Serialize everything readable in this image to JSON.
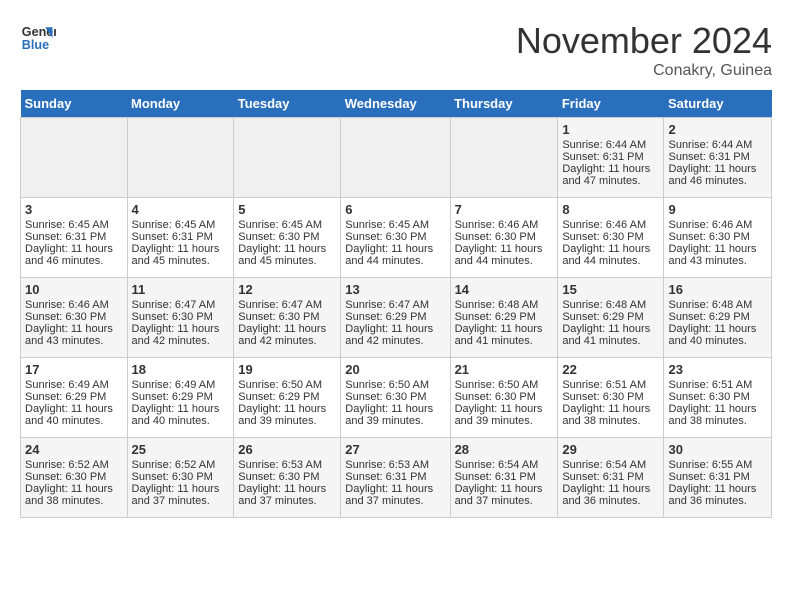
{
  "logo": {
    "line1": "General",
    "line2": "Blue"
  },
  "title": "November 2024",
  "subtitle": "Conakry, Guinea",
  "days_of_week": [
    "Sunday",
    "Monday",
    "Tuesday",
    "Wednesday",
    "Thursday",
    "Friday",
    "Saturday"
  ],
  "weeks": [
    [
      {
        "day": "",
        "content": ""
      },
      {
        "day": "",
        "content": ""
      },
      {
        "day": "",
        "content": ""
      },
      {
        "day": "",
        "content": ""
      },
      {
        "day": "",
        "content": ""
      },
      {
        "day": "1",
        "content": "Sunrise: 6:44 AM\nSunset: 6:31 PM\nDaylight: 11 hours and 47 minutes."
      },
      {
        "day": "2",
        "content": "Sunrise: 6:44 AM\nSunset: 6:31 PM\nDaylight: 11 hours and 46 minutes."
      }
    ],
    [
      {
        "day": "3",
        "content": "Sunrise: 6:45 AM\nSunset: 6:31 PM\nDaylight: 11 hours and 46 minutes."
      },
      {
        "day": "4",
        "content": "Sunrise: 6:45 AM\nSunset: 6:31 PM\nDaylight: 11 hours and 45 minutes."
      },
      {
        "day": "5",
        "content": "Sunrise: 6:45 AM\nSunset: 6:30 PM\nDaylight: 11 hours and 45 minutes."
      },
      {
        "day": "6",
        "content": "Sunrise: 6:45 AM\nSunset: 6:30 PM\nDaylight: 11 hours and 44 minutes."
      },
      {
        "day": "7",
        "content": "Sunrise: 6:46 AM\nSunset: 6:30 PM\nDaylight: 11 hours and 44 minutes."
      },
      {
        "day": "8",
        "content": "Sunrise: 6:46 AM\nSunset: 6:30 PM\nDaylight: 11 hours and 44 minutes."
      },
      {
        "day": "9",
        "content": "Sunrise: 6:46 AM\nSunset: 6:30 PM\nDaylight: 11 hours and 43 minutes."
      }
    ],
    [
      {
        "day": "10",
        "content": "Sunrise: 6:46 AM\nSunset: 6:30 PM\nDaylight: 11 hours and 43 minutes."
      },
      {
        "day": "11",
        "content": "Sunrise: 6:47 AM\nSunset: 6:30 PM\nDaylight: 11 hours and 42 minutes."
      },
      {
        "day": "12",
        "content": "Sunrise: 6:47 AM\nSunset: 6:30 PM\nDaylight: 11 hours and 42 minutes."
      },
      {
        "day": "13",
        "content": "Sunrise: 6:47 AM\nSunset: 6:29 PM\nDaylight: 11 hours and 42 minutes."
      },
      {
        "day": "14",
        "content": "Sunrise: 6:48 AM\nSunset: 6:29 PM\nDaylight: 11 hours and 41 minutes."
      },
      {
        "day": "15",
        "content": "Sunrise: 6:48 AM\nSunset: 6:29 PM\nDaylight: 11 hours and 41 minutes."
      },
      {
        "day": "16",
        "content": "Sunrise: 6:48 AM\nSunset: 6:29 PM\nDaylight: 11 hours and 40 minutes."
      }
    ],
    [
      {
        "day": "17",
        "content": "Sunrise: 6:49 AM\nSunset: 6:29 PM\nDaylight: 11 hours and 40 minutes."
      },
      {
        "day": "18",
        "content": "Sunrise: 6:49 AM\nSunset: 6:29 PM\nDaylight: 11 hours and 40 minutes."
      },
      {
        "day": "19",
        "content": "Sunrise: 6:50 AM\nSunset: 6:29 PM\nDaylight: 11 hours and 39 minutes."
      },
      {
        "day": "20",
        "content": "Sunrise: 6:50 AM\nSunset: 6:30 PM\nDaylight: 11 hours and 39 minutes."
      },
      {
        "day": "21",
        "content": "Sunrise: 6:50 AM\nSunset: 6:30 PM\nDaylight: 11 hours and 39 minutes."
      },
      {
        "day": "22",
        "content": "Sunrise: 6:51 AM\nSunset: 6:30 PM\nDaylight: 11 hours and 38 minutes."
      },
      {
        "day": "23",
        "content": "Sunrise: 6:51 AM\nSunset: 6:30 PM\nDaylight: 11 hours and 38 minutes."
      }
    ],
    [
      {
        "day": "24",
        "content": "Sunrise: 6:52 AM\nSunset: 6:30 PM\nDaylight: 11 hours and 38 minutes."
      },
      {
        "day": "25",
        "content": "Sunrise: 6:52 AM\nSunset: 6:30 PM\nDaylight: 11 hours and 37 minutes."
      },
      {
        "day": "26",
        "content": "Sunrise: 6:53 AM\nSunset: 6:30 PM\nDaylight: 11 hours and 37 minutes."
      },
      {
        "day": "27",
        "content": "Sunrise: 6:53 AM\nSunset: 6:31 PM\nDaylight: 11 hours and 37 minutes."
      },
      {
        "day": "28",
        "content": "Sunrise: 6:54 AM\nSunset: 6:31 PM\nDaylight: 11 hours and 37 minutes."
      },
      {
        "day": "29",
        "content": "Sunrise: 6:54 AM\nSunset: 6:31 PM\nDaylight: 11 hours and 36 minutes."
      },
      {
        "day": "30",
        "content": "Sunrise: 6:55 AM\nSunset: 6:31 PM\nDaylight: 11 hours and 36 minutes."
      }
    ]
  ]
}
